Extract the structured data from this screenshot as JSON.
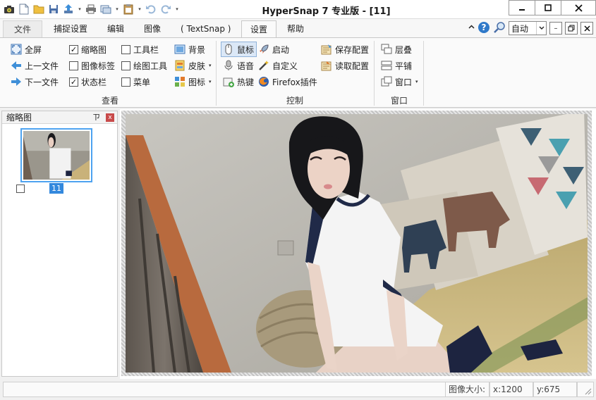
{
  "window": {
    "title": "HyperSnap 7 专业版 - [11]"
  },
  "tabs": [
    {
      "label": "文件"
    },
    {
      "label": "捕捉设置"
    },
    {
      "label": "编辑"
    },
    {
      "label": "图像"
    },
    {
      "label": "( TextSnap )"
    },
    {
      "label": "设置"
    },
    {
      "label": "帮助"
    }
  ],
  "active_tab": "设置",
  "zoom_combo": {
    "value": "自动"
  },
  "ribbon": {
    "view_group": {
      "name": "查看",
      "fullscreen": "全屏",
      "prev_file": "上一文件",
      "next_file": "下一文件",
      "thumbnail": "缩略图",
      "image_tabs": "图像标签",
      "statusbar": "状态栏",
      "toolbar": "工具栏",
      "draw_tools": "绘图工具",
      "menu": "菜单",
      "background": "背景",
      "skin": "皮肤",
      "icons": "图标"
    },
    "control_group": {
      "name": "控制",
      "mouse": "鼠标",
      "voice": "语音",
      "hotkey": "热键",
      "startup": "启动",
      "customize": "自定义",
      "firefox": "Firefox插件",
      "save_config": "保存配置",
      "load_config": "读取配置"
    },
    "window_group": {
      "name": "窗口",
      "cascade": "层叠",
      "tile": "平铺",
      "window": "窗口"
    }
  },
  "checkboxes": {
    "thumbnail": true,
    "image_tabs": false,
    "statusbar": true,
    "toolbar": false,
    "draw_tools": false,
    "menu": false
  },
  "thumbnail_panel": {
    "title": "缩略图",
    "pin_glyph": "ㄗ",
    "close_glyph": "x",
    "items": [
      {
        "label": "11"
      }
    ]
  },
  "status": {
    "size_label": "图像大小:",
    "x": "x:1200",
    "y": "y:675"
  },
  "glyphs": {
    "check": "✓",
    "dropdown": "▾",
    "minimize": "–",
    "restore": "▫"
  },
  "colors": {
    "accent_blue": "#3388dd",
    "thumb_border": "#4ea3f0",
    "ribbon_bg": "#fafafa",
    "close_red": "#c84a4a"
  },
  "icons": [
    "camera-icon",
    "new-file-icon",
    "open-folder-icon",
    "save-icon",
    "upload-icon",
    "print-icon",
    "copy-icon",
    "paste-icon",
    "undo-icon",
    "redo-icon",
    "help-icon",
    "search-icon"
  ]
}
